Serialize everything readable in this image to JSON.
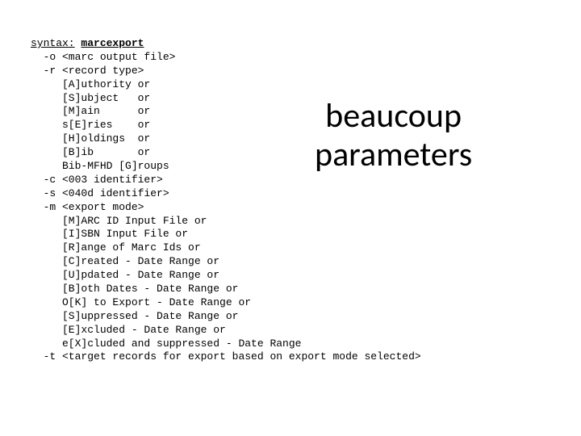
{
  "callout": {
    "line1": "beaucoup",
    "line2": "parameters"
  },
  "syntax": {
    "label": "syntax:",
    "cmd": "marcexport",
    "lines": [
      "  -o <marc output file>",
      "  -r <record type>",
      "     [A]uthority or",
      "     [S]ubject   or",
      "     [M]ain      or",
      "     s[E]ries    or",
      "     [H]oldings  or",
      "     [B]ib       or",
      "     Bib-MFHD [G]roups",
      "  -c <003 identifier>",
      "  -s <040d identifier>",
      "  -m <export mode>",
      "     [M]ARC ID Input File or",
      "     [I]SBN Input File or",
      "     [R]ange of Marc Ids or",
      "     [C]reated - Date Range or",
      "     [U]pdated - Date Range or",
      "     [B]oth Dates - Date Range or",
      "     O[K] to Export - Date Range or",
      "     [S]uppressed - Date Range or",
      "     [E]xcluded - Date Range or",
      "     e[X]cluded and suppressed - Date Range",
      "  -t <target records for export based on export mode selected>"
    ]
  }
}
